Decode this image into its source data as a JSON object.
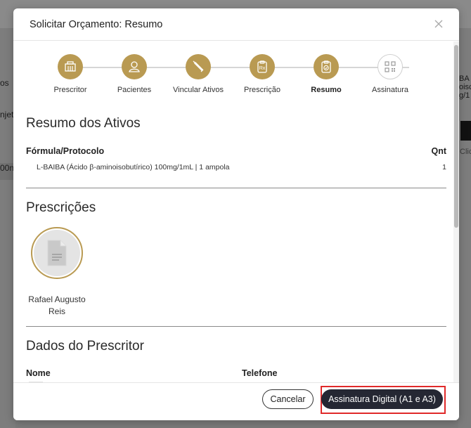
{
  "background": {
    "fragments": [
      "os",
      "njet",
      "00n",
      "BA (",
      "oisc",
      "g/1",
      "Clic"
    ]
  },
  "modal": {
    "title": "Solicitar Orçamento: Resumo",
    "steps": [
      {
        "label": "Prescritor",
        "icon": "building-icon",
        "state": "done"
      },
      {
        "label": "Pacientes",
        "icon": "patient-icon",
        "state": "done"
      },
      {
        "label": "Vincular Ativos",
        "icon": "syringe-icon",
        "state": "done"
      },
      {
        "label": "Prescrição",
        "icon": "prescription-icon",
        "state": "done"
      },
      {
        "label": "Resumo",
        "icon": "clipboard-check-icon",
        "state": "active"
      },
      {
        "label": "Assinatura",
        "icon": "qr-code-icon",
        "state": "pending"
      }
    ],
    "ativos": {
      "title": "Resumo dos Ativos",
      "col_formula": "Fórmula/Protocolo",
      "col_qnt": "Qnt",
      "rows": [
        {
          "formula": "L-BAIBA (Ácido β-aminoisobutírico) 100mg/1mL | 1 ampola",
          "qnt": "1"
        }
      ]
    },
    "prescricoes": {
      "title": "Prescrições",
      "items": [
        {
          "name": "Rafael Augusto Reis"
        }
      ]
    },
    "prescritor": {
      "title": "Dados do Prescritor",
      "col_nome": "Nome",
      "col_telefone": "Telefone"
    },
    "footer": {
      "cancel_label": "Cancelar",
      "sign_label": "Assinatura Digital (A1 e A3)"
    }
  },
  "colors": {
    "accent_gold": "#b99a52",
    "dark_button": "#252733",
    "highlight_red": "#e02a2a"
  }
}
